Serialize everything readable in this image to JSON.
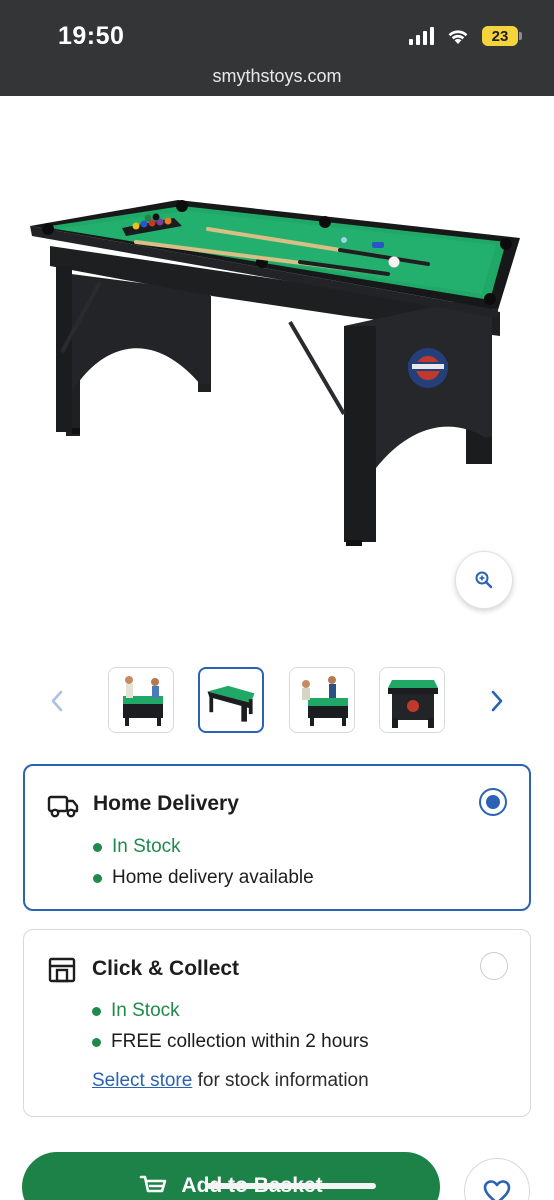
{
  "status_bar": {
    "time": "19:50",
    "battery": "23"
  },
  "browser": {
    "url": "smythstoys.com"
  },
  "product": {
    "image_icon": "pool-table-image",
    "thumbnails": [
      {
        "icon": "pool-table-players-photo"
      },
      {
        "icon": "pool-table-photo",
        "selected": true
      },
      {
        "icon": "pool-table-players-photo"
      },
      {
        "icon": "pool-table-front-photo"
      }
    ]
  },
  "delivery_options": [
    {
      "title": "Home Delivery",
      "icon": "truck-icon",
      "selected": true,
      "lines": [
        "In Stock",
        "Home delivery available"
      ]
    },
    {
      "title": "Click & Collect",
      "icon": "store-icon",
      "selected": false,
      "lines": [
        "In Stock",
        "FREE collection within 2 hours"
      ],
      "link_text": "Select store",
      "link_suffix": " for stock information"
    }
  ],
  "actions": {
    "add_to_basket": "Add to Basket",
    "wishlist_icon": "heart-icon"
  },
  "colors": {
    "primary_blue": "#2a63b3",
    "stock_green": "#1f8a4c",
    "button_green": "#1c8247",
    "felt_green": "#1fa866",
    "table_black": "#1b1c1e"
  }
}
